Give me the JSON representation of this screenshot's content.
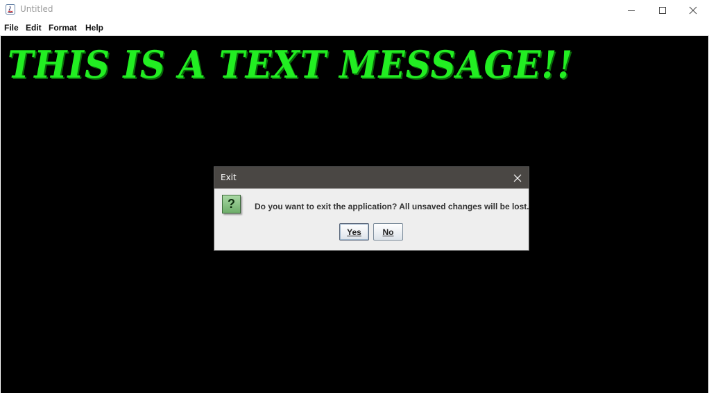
{
  "window": {
    "title": "Untitled",
    "controls": [
      "minimize-icon",
      "maximize-icon",
      "close-icon"
    ]
  },
  "menubar": {
    "items": [
      {
        "label": "File"
      },
      {
        "label": "Edit"
      },
      {
        "label": "Format"
      },
      {
        "label": "Help"
      }
    ]
  },
  "editor": {
    "text": "THIS IS A TEXT MESSAGE!!",
    "text_color": "#22ee22",
    "background_color": "#000000"
  },
  "dialog": {
    "title": "Exit",
    "icon": "question-icon",
    "icon_glyph": "?",
    "message": "Do you want to exit the application? All unsaved changes will be lost.",
    "yes_label": "Yes",
    "no_label": "No"
  }
}
